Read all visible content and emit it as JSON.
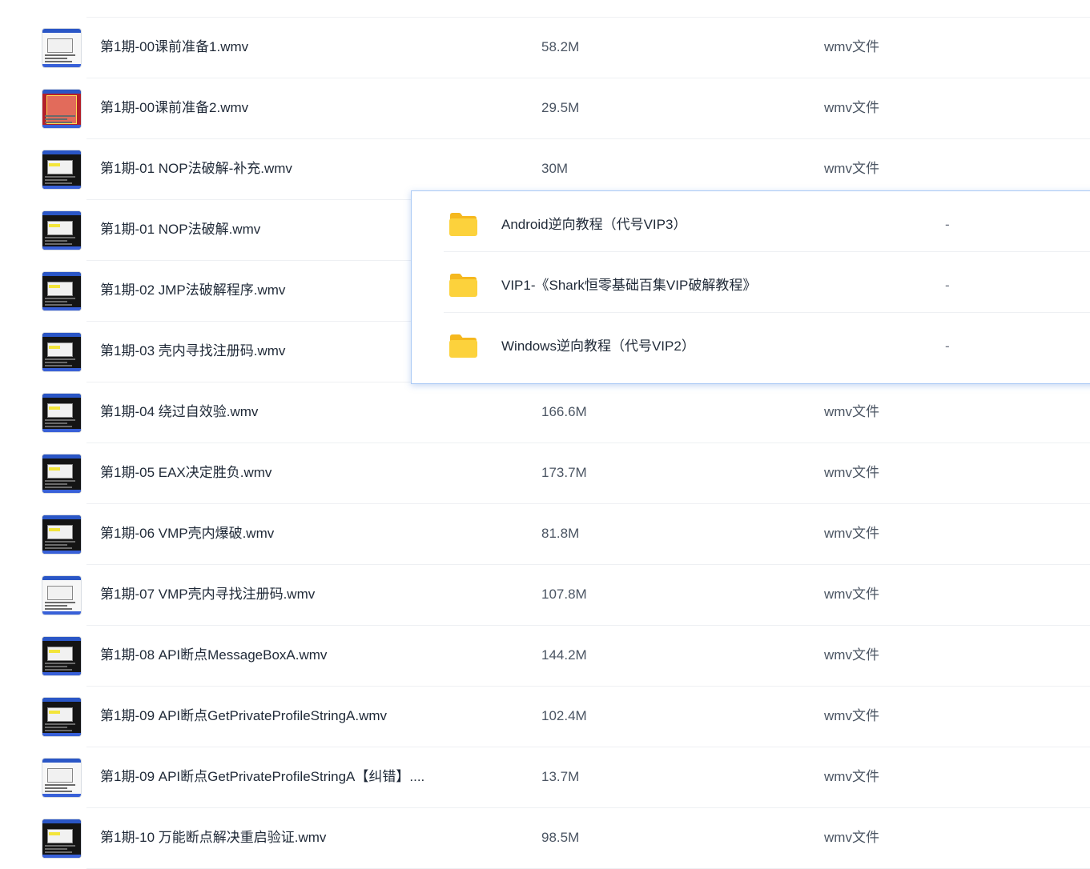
{
  "files": [
    {
      "name": "第1期-00课前准备1.wmv",
      "size": "58.2M",
      "type": "wmv文件",
      "thumb": "light"
    },
    {
      "name": "第1期-00课前准备2.wmv",
      "size": "29.5M",
      "type": "wmv文件",
      "thumb": "red"
    },
    {
      "name": "第1期-01 NOP法破解-补充.wmv",
      "size": "30M",
      "type": "wmv文件",
      "thumb": "dark"
    },
    {
      "name": "第1期-01 NOP法破解.wmv",
      "size": "",
      "type": "",
      "thumb": "dark"
    },
    {
      "name": "第1期-02 JMP法破解程序.wmv",
      "size": "",
      "type": "",
      "thumb": "dark"
    },
    {
      "name": "第1期-03 壳内寻找注册码.wmv",
      "size": "",
      "type": "",
      "thumb": "dark"
    },
    {
      "name": "第1期-04 绕过自效验.wmv",
      "size": "166.6M",
      "type": "wmv文件",
      "thumb": "dark"
    },
    {
      "name": "第1期-05 EAX决定胜负.wmv",
      "size": "173.7M",
      "type": "wmv文件",
      "thumb": "dark"
    },
    {
      "name": "第1期-06 VMP壳内爆破.wmv",
      "size": "81.8M",
      "type": "wmv文件",
      "thumb": "dark"
    },
    {
      "name": "第1期-07 VMP壳内寻找注册码.wmv",
      "size": "107.8M",
      "type": "wmv文件",
      "thumb": "light"
    },
    {
      "name": "第1期-08 API断点MessageBoxA.wmv",
      "size": "144.2M",
      "type": "wmv文件",
      "thumb": "dark"
    },
    {
      "name": "第1期-09 API断点GetPrivateProfileStringA.wmv",
      "size": "102.4M",
      "type": "wmv文件",
      "thumb": "dark"
    },
    {
      "name": "第1期-09 API断点GetPrivateProfileStringA【纠错】....",
      "size": "13.7M",
      "type": "wmv文件",
      "thumb": "light"
    },
    {
      "name": "第1期-10 万能断点解决重启验证.wmv",
      "size": "98.5M",
      "type": "wmv文件",
      "thumb": "dark"
    }
  ],
  "popup": {
    "folders": [
      {
        "name": "Android逆向教程（代号VIP3）",
        "size": "-",
        "icon": "folder-icon"
      },
      {
        "name": "VIP1-《Shark恒零基础百集VIP破解教程》",
        "size": "-",
        "icon": "folder-icon"
      },
      {
        "name": "Windows逆向教程（代号VIP2）",
        "size": "-",
        "icon": "folder-icon"
      }
    ]
  },
  "colors": {
    "folder": "#fcd23c",
    "folder_dark": "#f5b81e",
    "popup_border": "#a9c9f5"
  }
}
